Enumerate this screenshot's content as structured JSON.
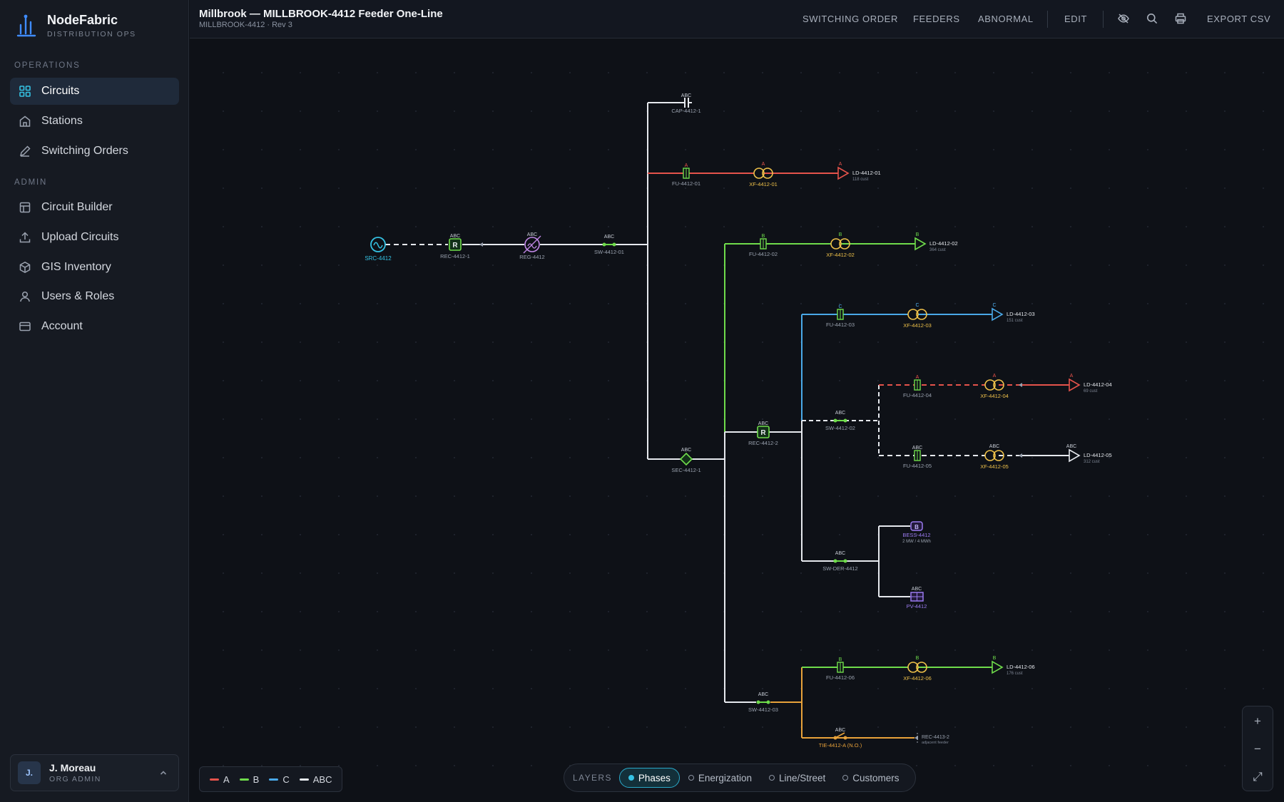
{
  "brand": {
    "name": "NodeFabric",
    "sub": "DISTRIBUTION OPS"
  },
  "sidebar": {
    "operations_label": "OPERATIONS",
    "admin_label": "ADMIN",
    "operations": [
      {
        "label": "Circuits",
        "icon": "grid-icon",
        "active": true
      },
      {
        "label": "Stations",
        "icon": "station-icon"
      },
      {
        "label": "Switching Orders",
        "icon": "pencil-icon"
      }
    ],
    "admin": [
      {
        "label": "Circuit Builder",
        "icon": "layout-icon"
      },
      {
        "label": "Upload Circuits",
        "icon": "upload-icon"
      },
      {
        "label": "GIS Inventory",
        "icon": "cube-icon"
      },
      {
        "label": "Users & Roles",
        "icon": "user-icon"
      },
      {
        "label": "Account",
        "icon": "card-icon"
      }
    ],
    "user": {
      "initials": "J.",
      "name": "J. Moreau",
      "role": "ORG ADMIN"
    }
  },
  "topbar": {
    "title": "Millbrook — MILLBROOK-4412 Feeder One-Line",
    "subtitle": "MILLBROOK-4412 · Rev 3",
    "links": {
      "switching_order": "SWITCHING ORDER",
      "feeders": "FEEDERS",
      "abnormal": "ABNORMAL",
      "edit": "EDIT",
      "export": "EXPORT CSV"
    },
    "icons": [
      "eye-off-icon",
      "search-icon",
      "print-icon"
    ]
  },
  "colors": {
    "phaseA": "#e5534b",
    "phaseB": "#6fdc4b",
    "phaseC": "#4aa9e8",
    "abc": "#e6e9ee",
    "tie": "#e8a23a",
    "transformer": "#f0c24a",
    "source": "#35c2e3",
    "regulator": "#c389e8",
    "der": "#9b7bf0"
  },
  "diagram": {
    "phase_abc": "ABC",
    "phase_a": "A",
    "phase_b": "B",
    "phase_c": "C",
    "src": "SRC-4412",
    "rec1": "REC-4412-1",
    "reg": "REG-4412",
    "sw01": "SW-4412-01",
    "cap": "CAP-4412-1",
    "fu01": "FU-4412-01",
    "xf01": "XF-4412-01",
    "ld01": "LD-4412-01",
    "ld01_cust": "118 cust",
    "fu02": "FU-4412-02",
    "xf02": "XF-4412-02",
    "ld02": "LD-4412-02",
    "ld02_cust": "364 cust",
    "fu03": "FU-4412-03",
    "xf03": "XF-4412-03",
    "ld03": "LD-4412-03",
    "ld03_cust": "151 cust",
    "fu04": "FU-4412-04",
    "xf04": "XF-4412-04",
    "ld04": "LD-4412-04",
    "ld04_cust": "69 cust",
    "fu05": "FU-4412-05",
    "xf05": "XF-4412-05",
    "ld05": "LD-4412-05",
    "ld05_cust": "312 cust",
    "sec": "SEC-4412-1",
    "rec2": "REC-4412-2",
    "sw02": "SW-4412-02",
    "bess": "BESS-4412",
    "bess_spec": "2 MW / 4 MWh",
    "swder": "SW-DER-4412",
    "pv": "PV-4412",
    "fu06": "FU-4412-06",
    "xf06": "XF-4412-06",
    "ld06": "LD-4412-06",
    "ld06_cust": "176 cust",
    "sw03": "SW-4412-03",
    "tie": "TIE-4412-A (N.O.)",
    "rec3": "REC-4413-2",
    "rec3_note": "adjacent feeder",
    "glyph_r": "R",
    "glyph_b": "B"
  },
  "legend": {
    "a": "A",
    "b": "B",
    "c": "C",
    "abc": "ABC"
  },
  "layers": {
    "label": "LAYERS",
    "items": [
      {
        "label": "Phases",
        "active": true
      },
      {
        "label": "Energization"
      },
      {
        "label": "Line/Street"
      },
      {
        "label": "Customers"
      }
    ]
  },
  "zoom": {
    "in": "+",
    "out": "−",
    "fit": "⤢"
  }
}
